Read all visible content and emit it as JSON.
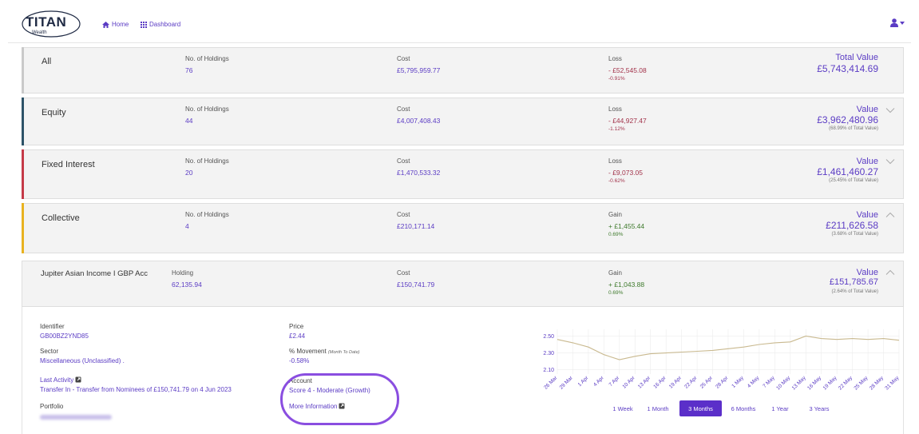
{
  "nav": {
    "logo_text": "TITAN",
    "logo_sub": "Wealth",
    "home_label": "Home",
    "dashboard_label": "Dashboard"
  },
  "summary": [
    {
      "name": "All",
      "holdings_label": "No. of Holdings",
      "holdings": "76",
      "cost_label": "Cost",
      "cost": "£5,795,959.77",
      "pl_label": "Loss",
      "pl": "- £52,545.08",
      "pl_pct": "-0.91%",
      "value_label": "Total Value",
      "value": "£5,743,414.69",
      "value_share": ""
    },
    {
      "name": "Equity",
      "holdings_label": "No. of Holdings",
      "holdings": "44",
      "cost_label": "Cost",
      "cost": "£4,007,408.43",
      "pl_label": "Loss",
      "pl": "- £44,927.47",
      "pl_pct": "-1.12%",
      "value_label": "Value",
      "value": "£3,962,480.96",
      "value_share": "(68.99% of Total Value)"
    },
    {
      "name": "Fixed Interest",
      "holdings_label": "No. of Holdings",
      "holdings": "20",
      "cost_label": "Cost",
      "cost": "£1,470,533.32",
      "pl_label": "Loss",
      "pl": "- £9,073.05",
      "pl_pct": "-0.62%",
      "value_label": "Value",
      "value": "£1,461,460.27",
      "value_share": "(25.45% of Total Value)"
    },
    {
      "name": "Collective",
      "holdings_label": "No. of Holdings",
      "holdings": "4",
      "cost_label": "Cost",
      "cost": "£210,171.14",
      "pl_label": "Gain",
      "pl": "+ £1,455.44",
      "pl_pct": "0.69%",
      "value_label": "Value",
      "value": "£211,626.58",
      "value_share": "(3.68% of Total Value)"
    }
  ],
  "holding": {
    "name": "Jupiter Asian Income I GBP Acc",
    "holding_label": "Holding",
    "holding": "62,135.94",
    "cost_label": "Cost",
    "cost": "£150,741.79",
    "pl_label": "Gain",
    "pl": "+ £1,043.88",
    "pl_pct": "0.69%",
    "value_label": "Value",
    "value": "£151,785.67",
    "value_share": "(2.64% of Total Value)"
  },
  "detail": {
    "identifier_label": "Identifier",
    "identifier": "GB00BZ2YND85",
    "sector_label": "Sector",
    "sector": "Miscellaneous (Unclassified) .",
    "last_activity_label": "Last Activity",
    "last_activity": "Transfer In - Transfer from Nominees of £150,741.79 on 4 Jun 2023",
    "portfolio_label": "Portfolio",
    "price_label": "Price",
    "price": "£2.44",
    "movement_label": "% Movement",
    "movement_note": "(Month To Date)",
    "movement": "-0.58%",
    "account_label": "Account",
    "account": "Score 4 - Moderate (Growth)",
    "more_info": "More Information"
  },
  "colors": {
    "accent": "#5b3cc4",
    "all_bar": "#c9c9c9",
    "equity_bar": "#2d5368",
    "fixed_bar": "#c53a48",
    "collective_bar": "#e8b220",
    "line": "#c9b98f",
    "highlight": "#8a4ee0"
  },
  "chart_data": {
    "type": "line",
    "y_ticks": [
      "2.50",
      "2.30",
      "2.10"
    ],
    "ylim": [
      2.05,
      2.58
    ],
    "x": [
      "26 Mar",
      "29 Mar",
      "1 Apr",
      "4 Apr",
      "7 Apr",
      "10 Apr",
      "13 Apr",
      "16 Apr",
      "19 Apr",
      "22 Apr",
      "25 Apr",
      "28 Apr",
      "1 May",
      "4 May",
      "7 May",
      "10 May",
      "13 May",
      "16 May",
      "19 May",
      "22 May",
      "25 May",
      "28 May",
      "31 May"
    ],
    "series": [
      {
        "values": [
          2.46,
          2.42,
          2.37,
          2.28,
          2.22,
          2.26,
          2.29,
          2.3,
          2.31,
          2.32,
          2.33,
          2.35,
          2.37,
          2.4,
          2.42,
          2.43,
          2.5,
          2.47,
          2.46,
          2.47,
          2.46,
          2.47,
          2.45
        ]
      }
    ],
    "grid": true,
    "range_buttons": [
      "1 Week",
      "1 Month",
      "3 Months",
      "6 Months",
      "1 Year",
      "3 Years"
    ],
    "selected_range": "3 Months"
  }
}
